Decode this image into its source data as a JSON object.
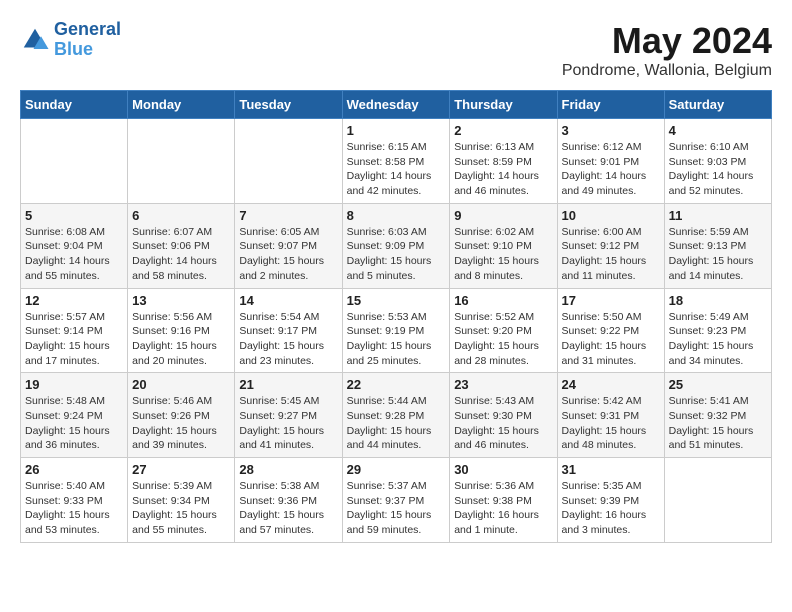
{
  "header": {
    "logo_line1": "General",
    "logo_line2": "Blue",
    "month_title": "May 2024",
    "location": "Pondrome, Wallonia, Belgium"
  },
  "weekdays": [
    "Sunday",
    "Monday",
    "Tuesday",
    "Wednesday",
    "Thursday",
    "Friday",
    "Saturday"
  ],
  "weeks": [
    [
      {
        "day": "",
        "info": ""
      },
      {
        "day": "",
        "info": ""
      },
      {
        "day": "",
        "info": ""
      },
      {
        "day": "1",
        "info": "Sunrise: 6:15 AM\nSunset: 8:58 PM\nDaylight: 14 hours and 42 minutes."
      },
      {
        "day": "2",
        "info": "Sunrise: 6:13 AM\nSunset: 8:59 PM\nDaylight: 14 hours and 46 minutes."
      },
      {
        "day": "3",
        "info": "Sunrise: 6:12 AM\nSunset: 9:01 PM\nDaylight: 14 hours and 49 minutes."
      },
      {
        "day": "4",
        "info": "Sunrise: 6:10 AM\nSunset: 9:03 PM\nDaylight: 14 hours and 52 minutes."
      }
    ],
    [
      {
        "day": "5",
        "info": "Sunrise: 6:08 AM\nSunset: 9:04 PM\nDaylight: 14 hours and 55 minutes."
      },
      {
        "day": "6",
        "info": "Sunrise: 6:07 AM\nSunset: 9:06 PM\nDaylight: 14 hours and 58 minutes."
      },
      {
        "day": "7",
        "info": "Sunrise: 6:05 AM\nSunset: 9:07 PM\nDaylight: 15 hours and 2 minutes."
      },
      {
        "day": "8",
        "info": "Sunrise: 6:03 AM\nSunset: 9:09 PM\nDaylight: 15 hours and 5 minutes."
      },
      {
        "day": "9",
        "info": "Sunrise: 6:02 AM\nSunset: 9:10 PM\nDaylight: 15 hours and 8 minutes."
      },
      {
        "day": "10",
        "info": "Sunrise: 6:00 AM\nSunset: 9:12 PM\nDaylight: 15 hours and 11 minutes."
      },
      {
        "day": "11",
        "info": "Sunrise: 5:59 AM\nSunset: 9:13 PM\nDaylight: 15 hours and 14 minutes."
      }
    ],
    [
      {
        "day": "12",
        "info": "Sunrise: 5:57 AM\nSunset: 9:14 PM\nDaylight: 15 hours and 17 minutes."
      },
      {
        "day": "13",
        "info": "Sunrise: 5:56 AM\nSunset: 9:16 PM\nDaylight: 15 hours and 20 minutes."
      },
      {
        "day": "14",
        "info": "Sunrise: 5:54 AM\nSunset: 9:17 PM\nDaylight: 15 hours and 23 minutes."
      },
      {
        "day": "15",
        "info": "Sunrise: 5:53 AM\nSunset: 9:19 PM\nDaylight: 15 hours and 25 minutes."
      },
      {
        "day": "16",
        "info": "Sunrise: 5:52 AM\nSunset: 9:20 PM\nDaylight: 15 hours and 28 minutes."
      },
      {
        "day": "17",
        "info": "Sunrise: 5:50 AM\nSunset: 9:22 PM\nDaylight: 15 hours and 31 minutes."
      },
      {
        "day": "18",
        "info": "Sunrise: 5:49 AM\nSunset: 9:23 PM\nDaylight: 15 hours and 34 minutes."
      }
    ],
    [
      {
        "day": "19",
        "info": "Sunrise: 5:48 AM\nSunset: 9:24 PM\nDaylight: 15 hours and 36 minutes."
      },
      {
        "day": "20",
        "info": "Sunrise: 5:46 AM\nSunset: 9:26 PM\nDaylight: 15 hours and 39 minutes."
      },
      {
        "day": "21",
        "info": "Sunrise: 5:45 AM\nSunset: 9:27 PM\nDaylight: 15 hours and 41 minutes."
      },
      {
        "day": "22",
        "info": "Sunrise: 5:44 AM\nSunset: 9:28 PM\nDaylight: 15 hours and 44 minutes."
      },
      {
        "day": "23",
        "info": "Sunrise: 5:43 AM\nSunset: 9:30 PM\nDaylight: 15 hours and 46 minutes."
      },
      {
        "day": "24",
        "info": "Sunrise: 5:42 AM\nSunset: 9:31 PM\nDaylight: 15 hours and 48 minutes."
      },
      {
        "day": "25",
        "info": "Sunrise: 5:41 AM\nSunset: 9:32 PM\nDaylight: 15 hours and 51 minutes."
      }
    ],
    [
      {
        "day": "26",
        "info": "Sunrise: 5:40 AM\nSunset: 9:33 PM\nDaylight: 15 hours and 53 minutes."
      },
      {
        "day": "27",
        "info": "Sunrise: 5:39 AM\nSunset: 9:34 PM\nDaylight: 15 hours and 55 minutes."
      },
      {
        "day": "28",
        "info": "Sunrise: 5:38 AM\nSunset: 9:36 PM\nDaylight: 15 hours and 57 minutes."
      },
      {
        "day": "29",
        "info": "Sunrise: 5:37 AM\nSunset: 9:37 PM\nDaylight: 15 hours and 59 minutes."
      },
      {
        "day": "30",
        "info": "Sunrise: 5:36 AM\nSunset: 9:38 PM\nDaylight: 16 hours and 1 minute."
      },
      {
        "day": "31",
        "info": "Sunrise: 5:35 AM\nSunset: 9:39 PM\nDaylight: 16 hours and 3 minutes."
      },
      {
        "day": "",
        "info": ""
      }
    ]
  ]
}
